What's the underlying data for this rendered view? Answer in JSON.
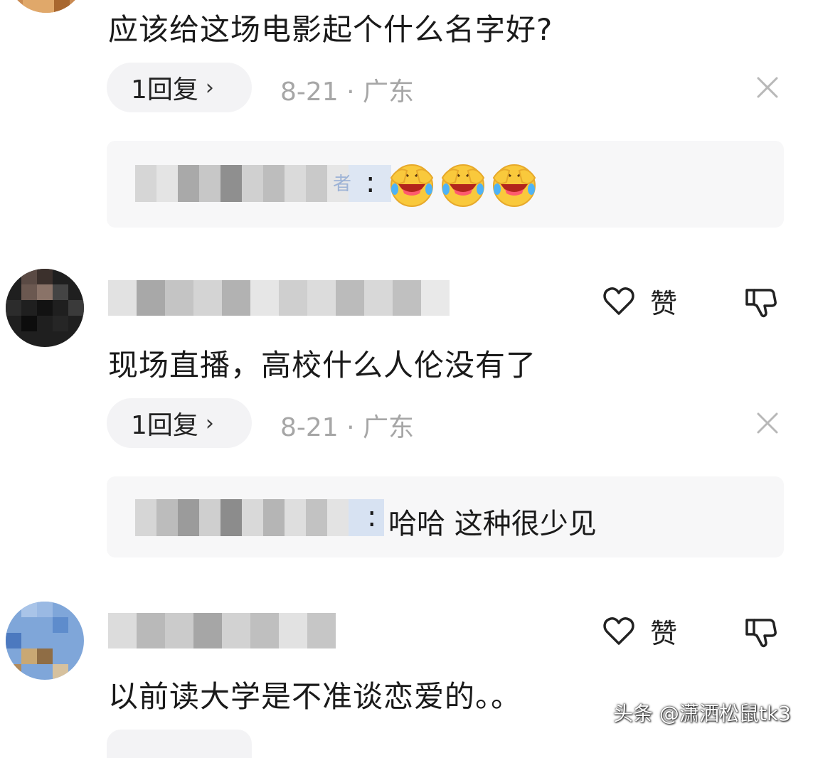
{
  "comment1": {
    "text": "应该给这场电影起个什么名字好?",
    "reply_count": "1回复",
    "chevron": "›",
    "meta": "8-21 · 广东",
    "reply_preview": {
      "author_suffix": "者",
      "separator": ":",
      "emojis": [
        "laughing-crying-emoji",
        "laughing-crying-emoji",
        "laughing-crying-emoji"
      ]
    }
  },
  "comment2": {
    "like_label": "赞",
    "text": "现场直播，高校什么人伦没有了",
    "reply_count": "1回复",
    "chevron": "›",
    "meta": "8-21 · 广东",
    "reply_preview": {
      "separator": ":",
      "text": "哈哈 这种很少见"
    }
  },
  "comment3": {
    "like_label": "赞",
    "text": "以前读大学是不准谈恋爱的。。"
  },
  "watermark": "头条 @潇洒松鼠tk3",
  "colors": {
    "meta_gray": "#a6a6a6",
    "pill_bg": "#f3f3f5",
    "reply_box_bg": "#f7f7f8",
    "text_dark": "#1a1a1a"
  },
  "icons": {
    "like": "heart-outline-icon",
    "dislike": "thumbs-down-outline-icon",
    "close": "close-icon",
    "chevron": "chevron-right-icon"
  }
}
